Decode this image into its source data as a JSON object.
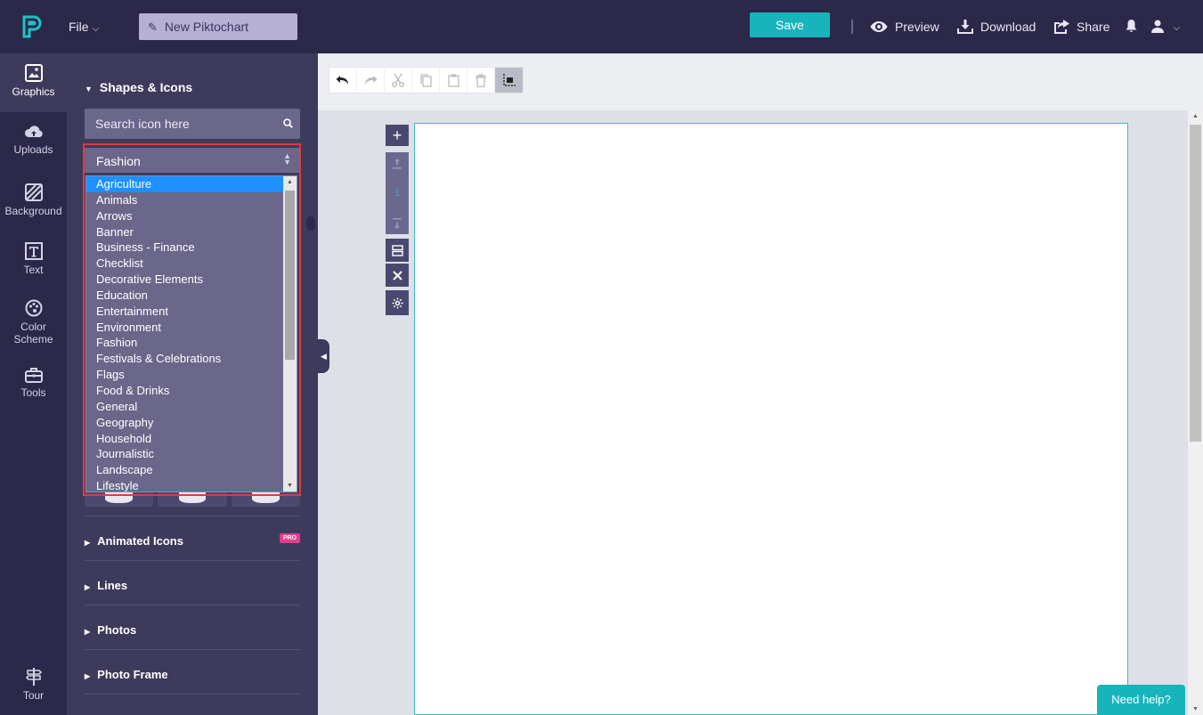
{
  "header": {
    "file_label": "File",
    "doc_title": "New Piktochart",
    "save_label": "Save",
    "preview_label": "Preview",
    "download_label": "Download",
    "share_label": "Share"
  },
  "rail": {
    "items": [
      {
        "label": "Graphics",
        "icon": "graphics-icon"
      },
      {
        "label": "Uploads",
        "icon": "cloud-upload-icon"
      },
      {
        "label": "Background",
        "icon": "background-icon"
      },
      {
        "label": "Text",
        "icon": "text-icon"
      },
      {
        "label": "Color",
        "label2": "Scheme",
        "icon": "palette-icon"
      },
      {
        "label": "Tools",
        "icon": "toolbox-icon"
      }
    ],
    "tour_label": "Tour"
  },
  "panel": {
    "heading": "Shapes & Icons",
    "search_placeholder": "Search icon here",
    "selected_category": "Fashion",
    "categories": [
      "Agriculture",
      "Animals",
      "Arrows",
      "Banner",
      "Business - Finance",
      "Checklist",
      "Decorative Elements",
      "Education",
      "Entertainment",
      "Environment",
      "Fashion",
      "Festivals & Celebrations",
      "Flags",
      "Food & Drinks",
      "General",
      "Geography",
      "Household",
      "Journalistic",
      "Landscape",
      "Lifestyle"
    ],
    "highlighted_category": "Agriculture",
    "sections": [
      {
        "label": "Animated Icons",
        "badge": "PRO"
      },
      {
        "label": "Lines"
      },
      {
        "label": "Photos"
      },
      {
        "label": "Photo Frame"
      }
    ]
  },
  "canvas": {
    "page_number": "1"
  },
  "help_label": "Need help?",
  "colors": {
    "accent": "#18b4bb",
    "nav_bg": "#2b2849",
    "panel_bg": "#3d3a5c",
    "selection": "#1e90ff",
    "highlight_frame": "#e03b3b",
    "pro_badge": "#e63b8a"
  }
}
